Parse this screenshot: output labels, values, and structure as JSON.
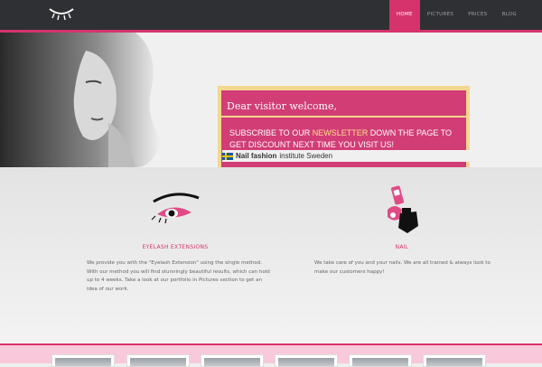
{
  "header": {
    "logo_icon": "closed-eye-lash-icon",
    "nav": [
      {
        "label": "Home",
        "active": true
      },
      {
        "label": "Pictures",
        "active": false
      },
      {
        "label": "Prices",
        "active": false
      },
      {
        "label": "Blog",
        "active": false
      }
    ]
  },
  "hero": {
    "welcome_title": "Dear visitor welcome,",
    "text_before": "SUBSCRIBE TO OUR ",
    "text_highlight": "NEWSLETTER",
    "text_after": " DOWN THE PAGE TO GET DISCOUNT NEXT TIME YOU VISIT US!",
    "subline_bold": "Nail fashion",
    "subline_rest": " institute Sweden"
  },
  "services": [
    {
      "title": "Eyelash extensions",
      "icon": "eye-makeup-icon",
      "text": "We provide you with the \"Eyelash Extension\" using the single method. With our method you will find stunningly beautiful results, which can hold up to 4 weeks. Take a look at our portfolio in Pictures section to get an idea of our work."
    },
    {
      "title": "Nail",
      "icon": "nail-polish-icon",
      "text": "We take care of you and your nails. We are all trained & always look to make our customers happy!"
    }
  ],
  "colors": {
    "accent": "#d6336c",
    "gold": "#f2d88f",
    "header_bg": "#2f3034"
  }
}
